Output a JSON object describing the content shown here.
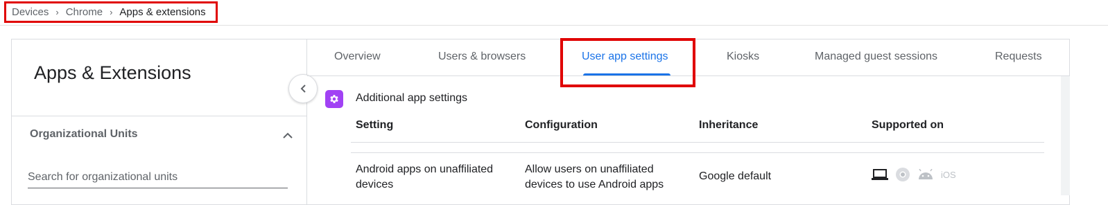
{
  "breadcrumb": {
    "items": [
      "Devices",
      "Chrome"
    ],
    "current": "Apps & extensions"
  },
  "left_panel": {
    "title": "Apps & Extensions",
    "org_units_label": "Organizational Units",
    "search_placeholder": "Search for organizational units"
  },
  "tabs": [
    {
      "label": "Overview"
    },
    {
      "label": "Users & browsers"
    },
    {
      "label": "User app settings",
      "active": true
    },
    {
      "label": "Kiosks"
    },
    {
      "label": "Managed guest sessions"
    },
    {
      "label": "Requests"
    }
  ],
  "section": {
    "title": "Additional app settings",
    "icon": "gear-icon"
  },
  "table": {
    "headers": [
      "Setting",
      "Configuration",
      "Inheritance",
      "Supported on"
    ],
    "rows": [
      {
        "setting": "Android apps on unaffiliated devices",
        "configuration": "Allow users on unaffiliated devices to use Android apps",
        "inheritance": "Google default",
        "supported_on": [
          "laptop-icon",
          "chrome-icon",
          "android-icon",
          "iOS"
        ]
      }
    ]
  },
  "colors": {
    "accent": "#1a73e8",
    "highlight": "#e00000",
    "settings_icon_bg": "#a142f4",
    "muted_icon": "#bdc1c6"
  }
}
